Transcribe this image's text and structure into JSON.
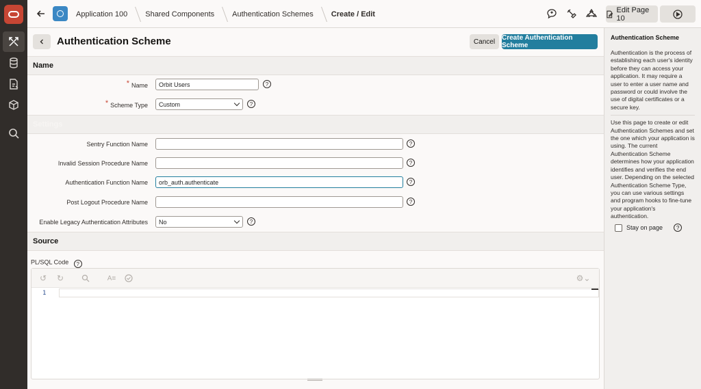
{
  "breadcrumb": {
    "items": [
      "Application 100",
      "Shared Components",
      "Authentication Schemes"
    ],
    "current": "Create / Edit"
  },
  "toolbar": {
    "edit_page_label": "Edit Page 10"
  },
  "page": {
    "title": "Authentication Scheme",
    "cancel_label": "Cancel",
    "create_label": "Create Authentication Scheme"
  },
  "sections": {
    "name": "Name",
    "settings": "Settings",
    "source": "Source"
  },
  "fields": {
    "name": {
      "label": "Name",
      "value": "Orbit Users"
    },
    "scheme_type": {
      "label": "Scheme Type",
      "value": "Custom"
    },
    "sentry": {
      "label": "Sentry Function Name",
      "value": ""
    },
    "invalid_session": {
      "label": "Invalid Session Procedure Name",
      "value": ""
    },
    "auth_function": {
      "label": "Authentication Function Name",
      "value": "orb_auth.authenticate"
    },
    "post_logout": {
      "label": "Post Logout Procedure Name",
      "value": ""
    },
    "legacy_attrs": {
      "label": "Enable Legacy Authentication Attributes",
      "value": "No"
    }
  },
  "source": {
    "plsql_label": "PL/SQL Code",
    "line_number": "1"
  },
  "help": {
    "title": "Authentication Scheme",
    "paragraph1": "Authentication is the process of establishing each user's identity before they can access your application. It may require a user to enter a user name and password or could involve the use of digital certificates or a secure key.",
    "paragraph2": "Use this page to create or edit Authentication Schemes and set the one which your application is using. The current Authentication Scheme determines how your application identifies and verifies the end user. Depending on the selected Authentication Scheme Type, you can use various settings and program hooks to fine-tune your application's authentication.",
    "stay_on_page": "Stay on page"
  },
  "colors": {
    "brand": "#c74634",
    "primary_button": "#227e9e",
    "app_icon": "#3b88c4",
    "rail": "#312d2a"
  }
}
